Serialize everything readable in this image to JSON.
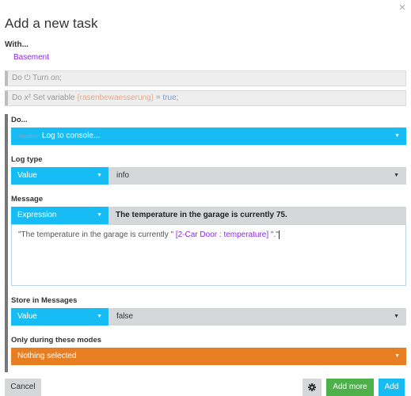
{
  "dialog": {
    "title": "Add a new task",
    "close_glyph": "×",
    "with_label": "With...",
    "device": "Basement"
  },
  "prior_actions": [
    {
      "prefix": "Do ",
      "icon": "power-icon",
      "icon_glyph": "⏻",
      "text": " Turn on;"
    },
    {
      "prefix": "Do ",
      "icon": "variable-icon",
      "icon_glyph": "x²",
      "text": " Set variable ",
      "var_name": "{rasenbewaesserung}",
      "equals": " = ",
      "value": "true",
      "end": ";"
    }
  ],
  "do_block": {
    "label": "Do...",
    "action_hint": "location",
    "action": "Log to console...",
    "log_type": {
      "label": "Log type",
      "mode": "Value",
      "value": "info"
    },
    "message": {
      "label": "Message",
      "mode": "Expression",
      "preview": "The temperature in the garage is currently 75.",
      "expr_string": "\"The temperature in the garage is currently \" ",
      "expr_var": "[2-Car Door : temperature]",
      "expr_end": " \".\""
    },
    "store": {
      "label": "Store in Messages",
      "mode": "Value",
      "value": "false"
    },
    "modes": {
      "label": "Only during these modes",
      "value": "Nothing selected"
    }
  },
  "footer": {
    "cancel": "Cancel",
    "gear_icon": "gear-icon",
    "add_more": "Add more",
    "add": "Add"
  },
  "colors": {
    "blue": "#18bcf5",
    "green": "#4db04a",
    "orange": "#e87e22",
    "grey": "#d5d7d9",
    "purple": "#8a2be2"
  }
}
